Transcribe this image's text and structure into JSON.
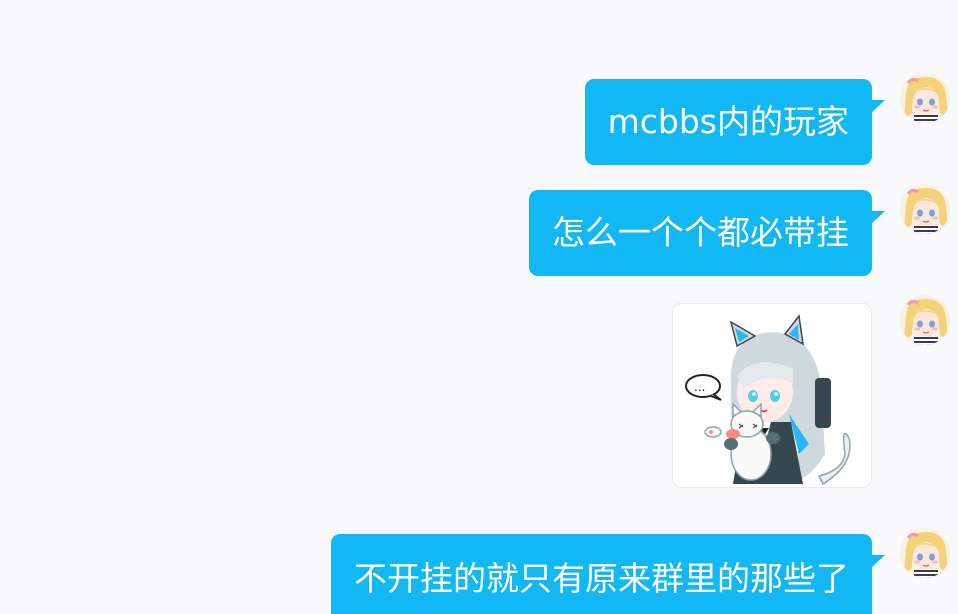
{
  "messages": [
    {
      "text": "mcbbs内的玩家"
    },
    {
      "text": "怎么一个个都必带挂"
    },
    {
      "sticker": "catgirl-with-cat-sticker",
      "speech": "..."
    },
    {
      "text": "不开挂的就只有原来群里的那些了"
    }
  ],
  "avatar_icon": "anime-girl-avatar",
  "colors": {
    "bubble": "#12b7f5",
    "background": "#f9f9fc",
    "text": "#ffffff"
  }
}
